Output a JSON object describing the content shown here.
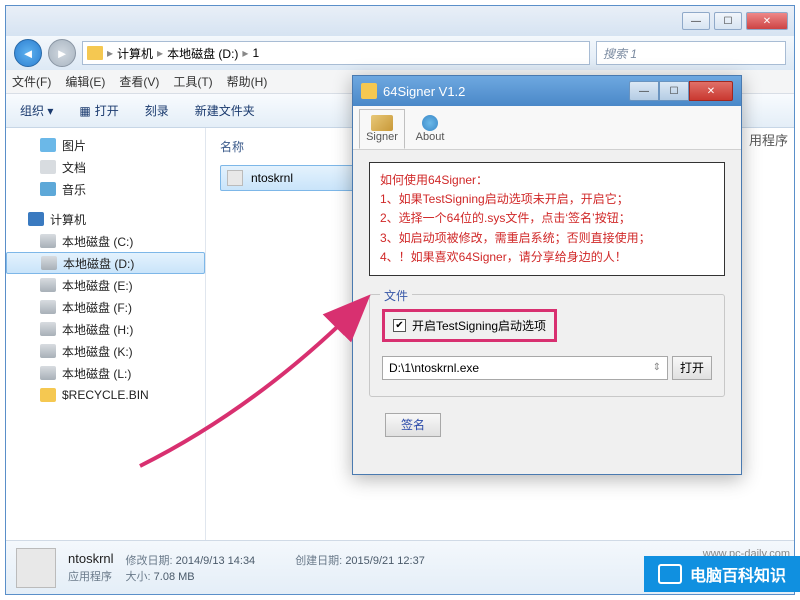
{
  "explorer": {
    "breadcrumb": {
      "root": "计算机",
      "drive": "本地磁盘 (D:)",
      "folder": "1"
    },
    "search_placeholder": "搜索 1",
    "menu": {
      "file": "文件(F)",
      "edit": "编辑(E)",
      "view": "查看(V)",
      "tools": "工具(T)",
      "help": "帮助(H)"
    },
    "toolbar": {
      "organize": "组织 ▾",
      "open": "打开",
      "burn": "刻录",
      "newfolder": "新建文件夹"
    },
    "sidebar": {
      "pictures": "图片",
      "documents": "文档",
      "music": "音乐",
      "computer": "计算机",
      "drives": [
        "本地磁盘 (C:)",
        "本地磁盘 (D:)",
        "本地磁盘 (E:)",
        "本地磁盘 (F:)",
        "本地磁盘 (H:)",
        "本地磁盘 (K:)",
        "本地磁盘 (L:)"
      ],
      "recycle": "$RECYCLE.BIN"
    },
    "content": {
      "col_name": "名称",
      "file": "ntoskrnl"
    },
    "details": {
      "name": "ntoskrnl",
      "type": "应用程序",
      "mod_label": "修改日期:",
      "mod_value": "2014/9/13 14:34",
      "size_label": "大小:",
      "size_value": "7.08 MB",
      "create_label": "创建日期:",
      "create_value": "2015/9/21 12:37"
    }
  },
  "dialog": {
    "title": "64Signer V1.2",
    "tabs": {
      "signer": "Signer",
      "about": "About"
    },
    "instructions": {
      "heading": "如何使用64Signer：",
      "line1": "1、如果TestSigning启动选项未开启，开启它；",
      "line2": "2、选择一个64位的.sys文件，点击‘签名’按钮；",
      "line3": "3、如启动项被修改，需重启系统；否则直接使用；",
      "line4": "4、！如果喜欢64Signer，请分享给身边的人！"
    },
    "file_group": {
      "legend": "文件",
      "checkbox_label": "开启TestSigning启动选项",
      "path": "D:\\1\\ntoskrnl.exe",
      "open_btn": "打开"
    },
    "sign_btn": "签名"
  },
  "watermark": {
    "side_text": "用程序",
    "brand": "电脑百科知识",
    "url": "www.pc-daily.com"
  }
}
